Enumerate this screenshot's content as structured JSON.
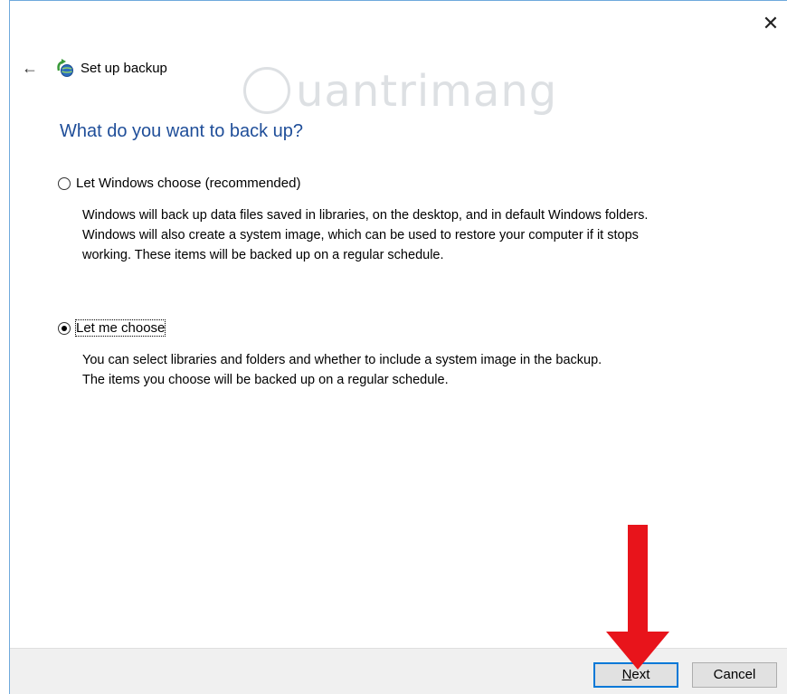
{
  "window": {
    "close_symbol": "✕"
  },
  "nav": {
    "back_symbol": "←",
    "title": "Set up backup"
  },
  "watermark": {
    "text": "uantrimang"
  },
  "page": {
    "heading": "What do you want to back up?"
  },
  "options": [
    {
      "label": "Let Windows choose (recommended)",
      "checked": false,
      "description_lines": [
        "Windows will back up data files saved in libraries, on the desktop, and in default Windows folders.",
        "Windows will also create a system image, which can be used to restore your computer if it stops",
        "working. These items will be backed up on a regular schedule."
      ]
    },
    {
      "label": "Let me choose",
      "checked": true,
      "description_lines": [
        "You can select libraries and folders and whether to include a system image in the backup.",
        "The items you choose will be backed up on a regular schedule."
      ]
    }
  ],
  "footer": {
    "next_label_underlined": "N",
    "next_label_rest": "ext",
    "cancel_label": "Cancel"
  },
  "colors": {
    "heading": "#1f4e99",
    "annotation_arrow": "#e8141b",
    "focus_border": "#0078d7"
  },
  "icons": [
    "close-icon",
    "back-arrow-icon",
    "backup-wizard-icon",
    "red-down-arrow-annotation"
  ]
}
